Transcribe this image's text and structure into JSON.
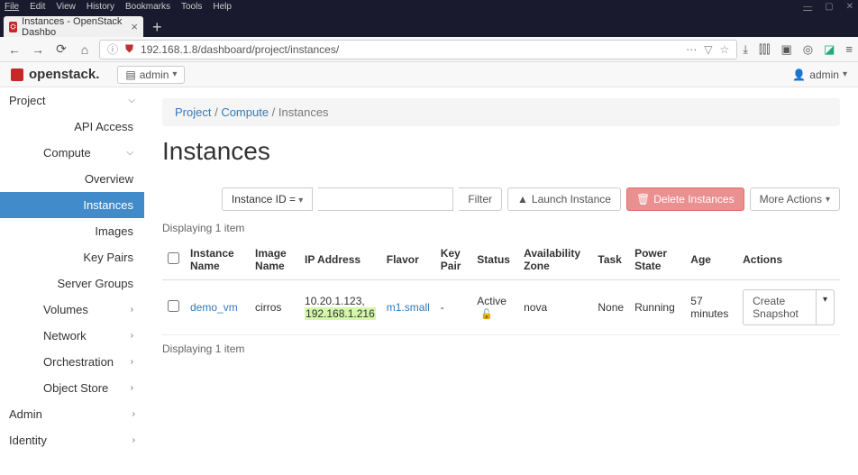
{
  "browser": {
    "menus": [
      "File",
      "Edit",
      "View",
      "History",
      "Bookmarks",
      "Tools",
      "Help"
    ],
    "tab_title": "Instances - OpenStack Dashbo",
    "url": "192.168.1.8/dashboard/project/instances/"
  },
  "topbar": {
    "brand": "openstack.",
    "domain_btn": "admin",
    "user_btn": "admin"
  },
  "sidebar": {
    "project": "Project",
    "api_access": "API Access",
    "compute": "Compute",
    "overview": "Overview",
    "instances": "Instances",
    "images": "Images",
    "keypairs": "Key Pairs",
    "servergroups": "Server Groups",
    "volumes": "Volumes",
    "network": "Network",
    "orchestration": "Orchestration",
    "objectstore": "Object Store",
    "admin": "Admin",
    "identity": "Identity"
  },
  "breadcrumb": {
    "a": "Project",
    "b": "Compute",
    "c": "Instances"
  },
  "page": {
    "title": "Instances",
    "filter_select": "Instance ID =",
    "filter_btn": "Filter",
    "launch_btn": "Launch Instance",
    "delete_btn": "Delete Instances",
    "more_btn": "More Actions",
    "count_top": "Displaying 1 item",
    "count_bottom": "Displaying 1 item"
  },
  "table": {
    "headers": {
      "name": "Instance Name",
      "image": "Image Name",
      "ip": "IP Address",
      "flavor": "Flavor",
      "keypair": "Key Pair",
      "status": "Status",
      "az": "Availability Zone",
      "task": "Task",
      "power": "Power State",
      "age": "Age",
      "actions": "Actions"
    },
    "row": {
      "name": "demo_vm",
      "image": "cirros",
      "ip1": "10.20.1.123,",
      "ip2": "192.168.1.216",
      "flavor": "m1.small",
      "keypair": "-",
      "status": "Active",
      "az": "nova",
      "task": "None",
      "power": "Running",
      "age": "57 minutes",
      "action": "Create Snapshot"
    }
  }
}
